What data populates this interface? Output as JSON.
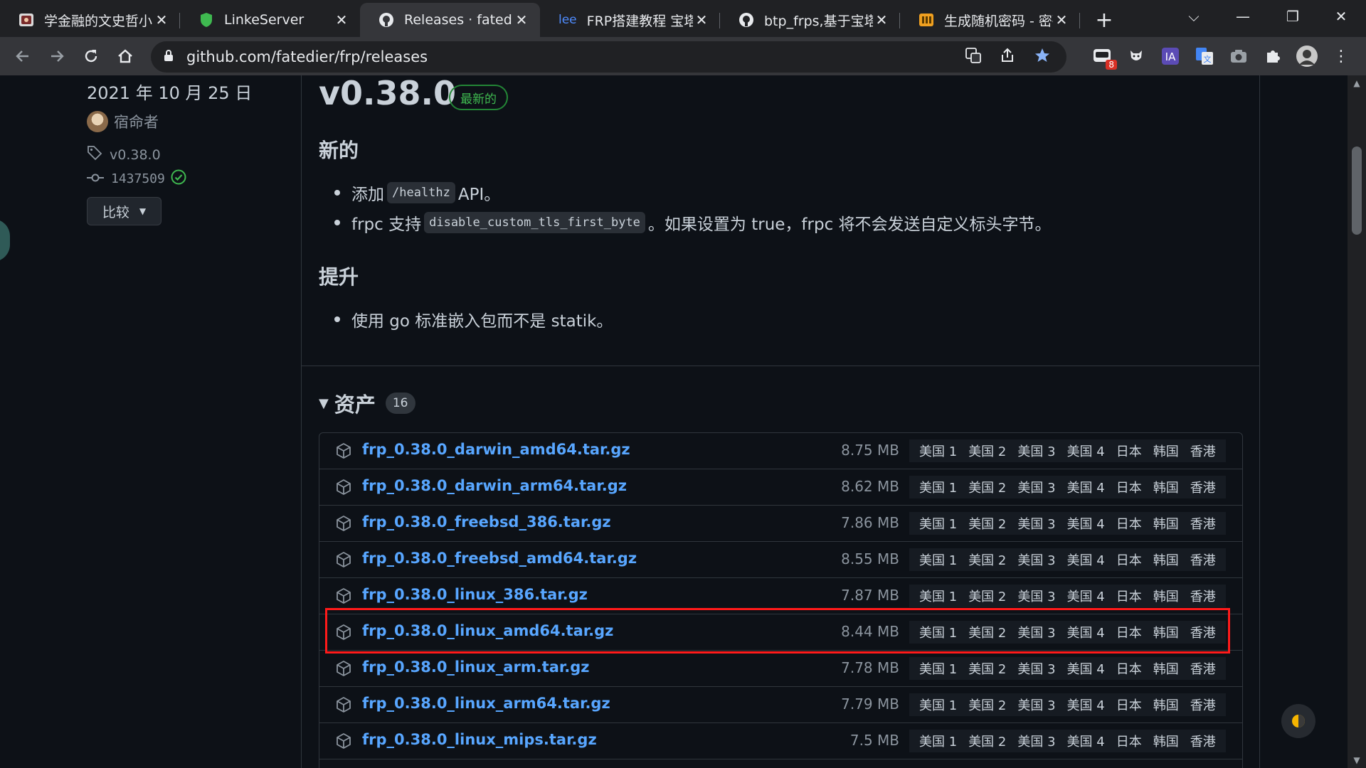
{
  "browser": {
    "tabs": [
      {
        "title": "学金融的文史哲小生",
        "favicon": "bilibili-icon",
        "active": false
      },
      {
        "title": "LinkeServer",
        "favicon": "shield-icon",
        "active": false
      },
      {
        "title": "Releases · fatedier",
        "favicon": "github-icon",
        "active": true
      },
      {
        "title": "FRP搭建教程 宝塔面板",
        "favicon": "lee-text-icon",
        "favicon_text": "lee",
        "active": false
      },
      {
        "title": "btp_frps,基于宝塔面板",
        "favicon": "github-icon",
        "active": false
      },
      {
        "title": "生成随机密码 - 密码",
        "favicon": "toolbox-icon",
        "active": false
      }
    ],
    "url": "github.com/fatedier/frp/releases",
    "extension_badge": "8",
    "accent": "#8ab4f8"
  },
  "sidebar": {
    "date": "2021 年 10 月 25 日",
    "author": "宿命者",
    "tag": "v0.38.0",
    "commit": "1437509",
    "compare_label": "比较"
  },
  "release": {
    "title": "v0.38.0",
    "badge": "最新的",
    "sections": [
      {
        "heading": "新的"
      },
      {
        "heading": "提升"
      }
    ],
    "bullets": {
      "b1_pre": "添加",
      "b1_code": "/healthz",
      "b1_post": "API。",
      "b2_pre": "frpc 支持",
      "b2_code": "disable_custom_tls_first_byte",
      "b2_post": "。如果设置为 true，frpc 将不会发送自定义标头字节。",
      "b3": "使用 go 标准嵌入包而不是 statik。"
    }
  },
  "assets": {
    "heading": "资产",
    "count": "16",
    "mirrors": [
      "美国 1",
      "美国 2",
      "美国 3",
      "美国 4",
      "日本",
      "韩国",
      "香港"
    ],
    "rows": [
      {
        "name": "frp_0.38.0_darwin_amd64.tar.gz",
        "size": "8.75 MB"
      },
      {
        "name": "frp_0.38.0_darwin_arm64.tar.gz",
        "size": "8.62 MB"
      },
      {
        "name": "frp_0.38.0_freebsd_386.tar.gz",
        "size": "7.86 MB"
      },
      {
        "name": "frp_0.38.0_freebsd_amd64.tar.gz",
        "size": "8.55 MB"
      },
      {
        "name": "frp_0.38.0_linux_386.tar.gz",
        "size": "7.87 MB"
      },
      {
        "name": "frp_0.38.0_linux_amd64.tar.gz",
        "size": "8.44 MB"
      },
      {
        "name": "frp_0.38.0_linux_arm.tar.gz",
        "size": "7.78 MB"
      },
      {
        "name": "frp_0.38.0_linux_arm64.tar.gz",
        "size": "7.79 MB"
      },
      {
        "name": "frp_0.38.0_linux_mips.tar.gz",
        "size": "7.5 MB"
      }
    ],
    "highlight_color": "#ff1a1a",
    "link_color": "#58a6ff"
  }
}
